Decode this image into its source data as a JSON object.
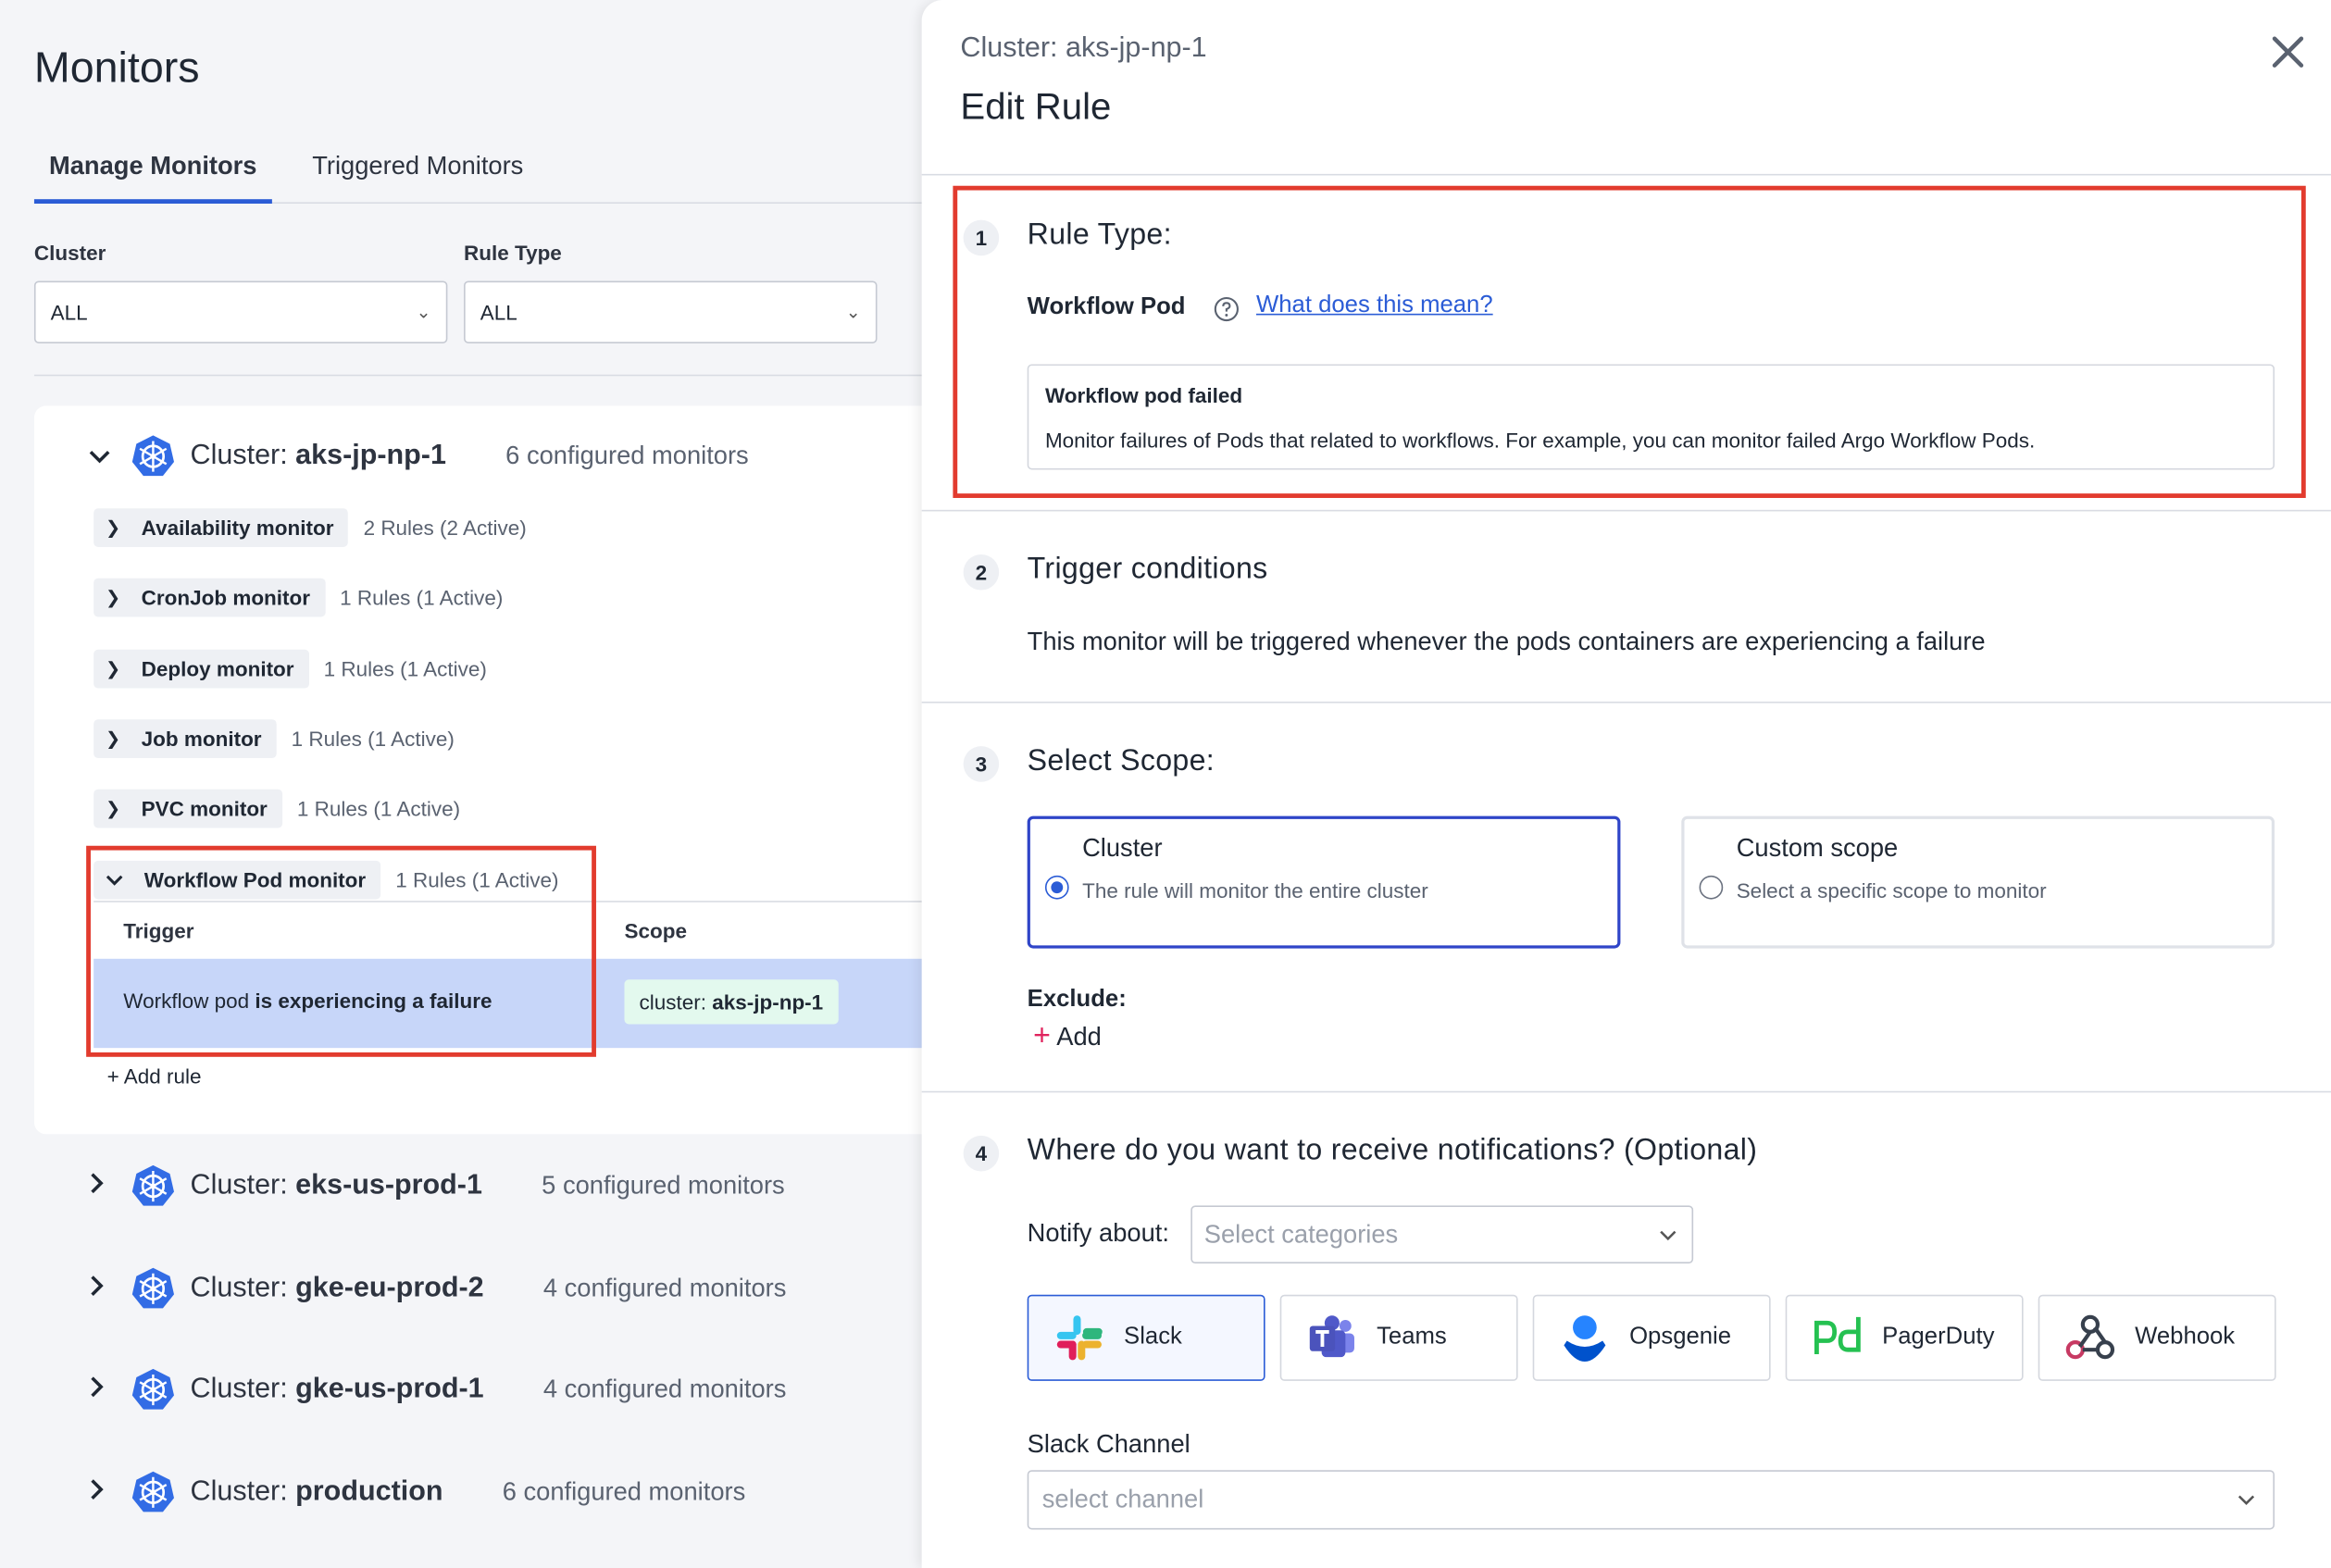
{
  "page": {
    "title": "Monitors"
  },
  "tabs": [
    {
      "label": "Manage Monitors",
      "active": true
    },
    {
      "label": "Triggered Monitors",
      "active": false
    }
  ],
  "filters": {
    "cluster": {
      "label": "Cluster",
      "value": "ALL"
    },
    "rule_type": {
      "label": "Rule Type",
      "value": "ALL"
    }
  },
  "expanded_cluster": {
    "prefix": "Cluster: ",
    "name": "aks-jp-np-1",
    "count": "6 configured monitors",
    "monitors": [
      {
        "name": "Availability monitor",
        "rules": "2 Rules (2 Active)"
      },
      {
        "name": "CronJob monitor",
        "rules": "1 Rules (1 Active)"
      },
      {
        "name": "Deploy monitor",
        "rules": "1 Rules (1 Active)"
      },
      {
        "name": "Job monitor",
        "rules": "1 Rules (1 Active)"
      },
      {
        "name": "PVC monitor",
        "rules": "1 Rules (1 Active)"
      },
      {
        "name": "Workflow Pod monitor",
        "rules": "1 Rules (1 Active)"
      }
    ],
    "table": {
      "headers": [
        "Trigger",
        "Scope"
      ],
      "row": {
        "trigger_plain": "Workflow pod ",
        "trigger_bold": "is experiencing a failure",
        "scope_prefix": "cluster: ",
        "scope_value": "aks-jp-np-1"
      }
    },
    "add_rule": "+ Add rule"
  },
  "other_clusters": [
    {
      "prefix": "Cluster: ",
      "name": "eks-us-prod-1",
      "count": "5 configured monitors"
    },
    {
      "prefix": "Cluster: ",
      "name": "gke-eu-prod-2",
      "count": "4 configured monitors"
    },
    {
      "prefix": "Cluster: ",
      "name": "gke-us-prod-1",
      "count": "4 configured monitors"
    },
    {
      "prefix": "Cluster: ",
      "name": "production",
      "count": "6 configured monitors"
    }
  ],
  "drawer": {
    "subtitle": "Cluster: aks-jp-np-1",
    "title": "Edit Rule",
    "step1": {
      "num": "1",
      "title": "Rule Type:",
      "type_label": "Workflow Pod",
      "help_link": "What does this mean?",
      "box_title": "Workflow pod failed",
      "box_desc": "Monitor failures of Pods that related to workflows. For example, you can monitor failed Argo Workflow Pods."
    },
    "step2": {
      "num": "2",
      "title": "Trigger conditions",
      "text": "This monitor will be triggered whenever the pods containers are experiencing a failure"
    },
    "step3": {
      "num": "3",
      "title": "Select Scope:",
      "options": [
        {
          "title": "Cluster",
          "desc": "The rule will monitor the entire cluster",
          "selected": true
        },
        {
          "title": "Custom scope",
          "desc": "Select a specific scope to monitor",
          "selected": false
        }
      ],
      "exclude_label": "Exclude:",
      "exclude_add": "Add"
    },
    "step4": {
      "num": "4",
      "title": "Where do you want to receive notifications? (Optional)",
      "notify_label": "Notify about:",
      "notify_placeholder": "Select categories",
      "channels": [
        {
          "label": "Slack",
          "icon": "slack-icon",
          "selected": true
        },
        {
          "label": "Teams",
          "icon": "teams-icon",
          "selected": false
        },
        {
          "label": "Opsgenie",
          "icon": "opsgenie-icon",
          "selected": false
        },
        {
          "label": "PagerDuty",
          "icon": "pagerduty-icon",
          "selected": false
        },
        {
          "label": "Webhook",
          "icon": "webhook-icon",
          "selected": false
        }
      ],
      "slack_channel_label": "Slack Channel",
      "slack_channel_placeholder": "select channel"
    }
  },
  "colors": {
    "accent": "#2b5cd6",
    "highlight_box": "#e23b2e",
    "selected_row": "#c7d6f9",
    "scope_chip": "#e3f9ee",
    "k8s_blue": "#326ce5"
  }
}
